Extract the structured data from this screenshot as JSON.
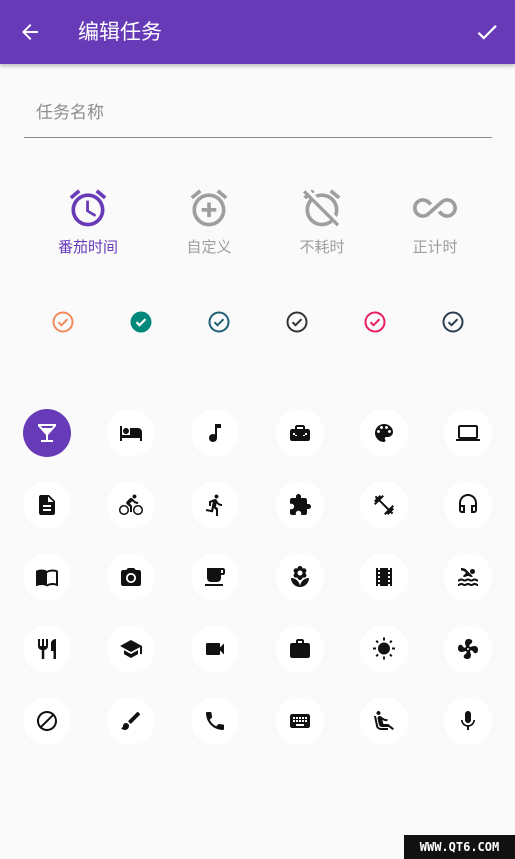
{
  "header": {
    "title": "编辑任务",
    "accent": "#673ab7"
  },
  "task_name": {
    "placeholder": "任务名称",
    "value": ""
  },
  "modes": [
    {
      "label": "番茄时间",
      "icon": "alarm-icon",
      "selected": true
    },
    {
      "label": "自定义",
      "icon": "alarm-add-icon",
      "selected": false
    },
    {
      "label": "不耗时",
      "icon": "alarm-off-icon",
      "selected": false
    },
    {
      "label": "正计时",
      "icon": "infinity-icon",
      "selected": false
    }
  ],
  "colors": [
    {
      "color": "#f08a5d",
      "selected": false
    },
    {
      "color": "#00897b",
      "selected": true
    },
    {
      "color": "#1e5f74",
      "selected": false
    },
    {
      "color": "#333333",
      "selected": false
    },
    {
      "color": "#e91e63",
      "selected": false
    },
    {
      "color": "#2c3e50",
      "selected": false
    }
  ],
  "icons": [
    "cocktail-icon",
    "bed-icon",
    "music-note-icon",
    "toolbox-icon",
    "palette-icon",
    "laptop-icon",
    "document-icon",
    "bike-icon",
    "run-icon",
    "puzzle-icon",
    "dumbbell-icon",
    "headphones-icon",
    "book-icon",
    "camera-icon",
    "coffee-icon",
    "flower-icon",
    "film-icon",
    "pool-icon",
    "restaurant-icon",
    "school-icon",
    "videocam-icon",
    "briefcase-icon",
    "sun-icon",
    "fan-icon",
    "block-icon",
    "brush-icon",
    "phone-icon",
    "keyboard-icon",
    "seat-icon",
    "mic-icon"
  ],
  "selected_icon": "cocktail-icon",
  "watermark": "WWW.QT6.COM"
}
